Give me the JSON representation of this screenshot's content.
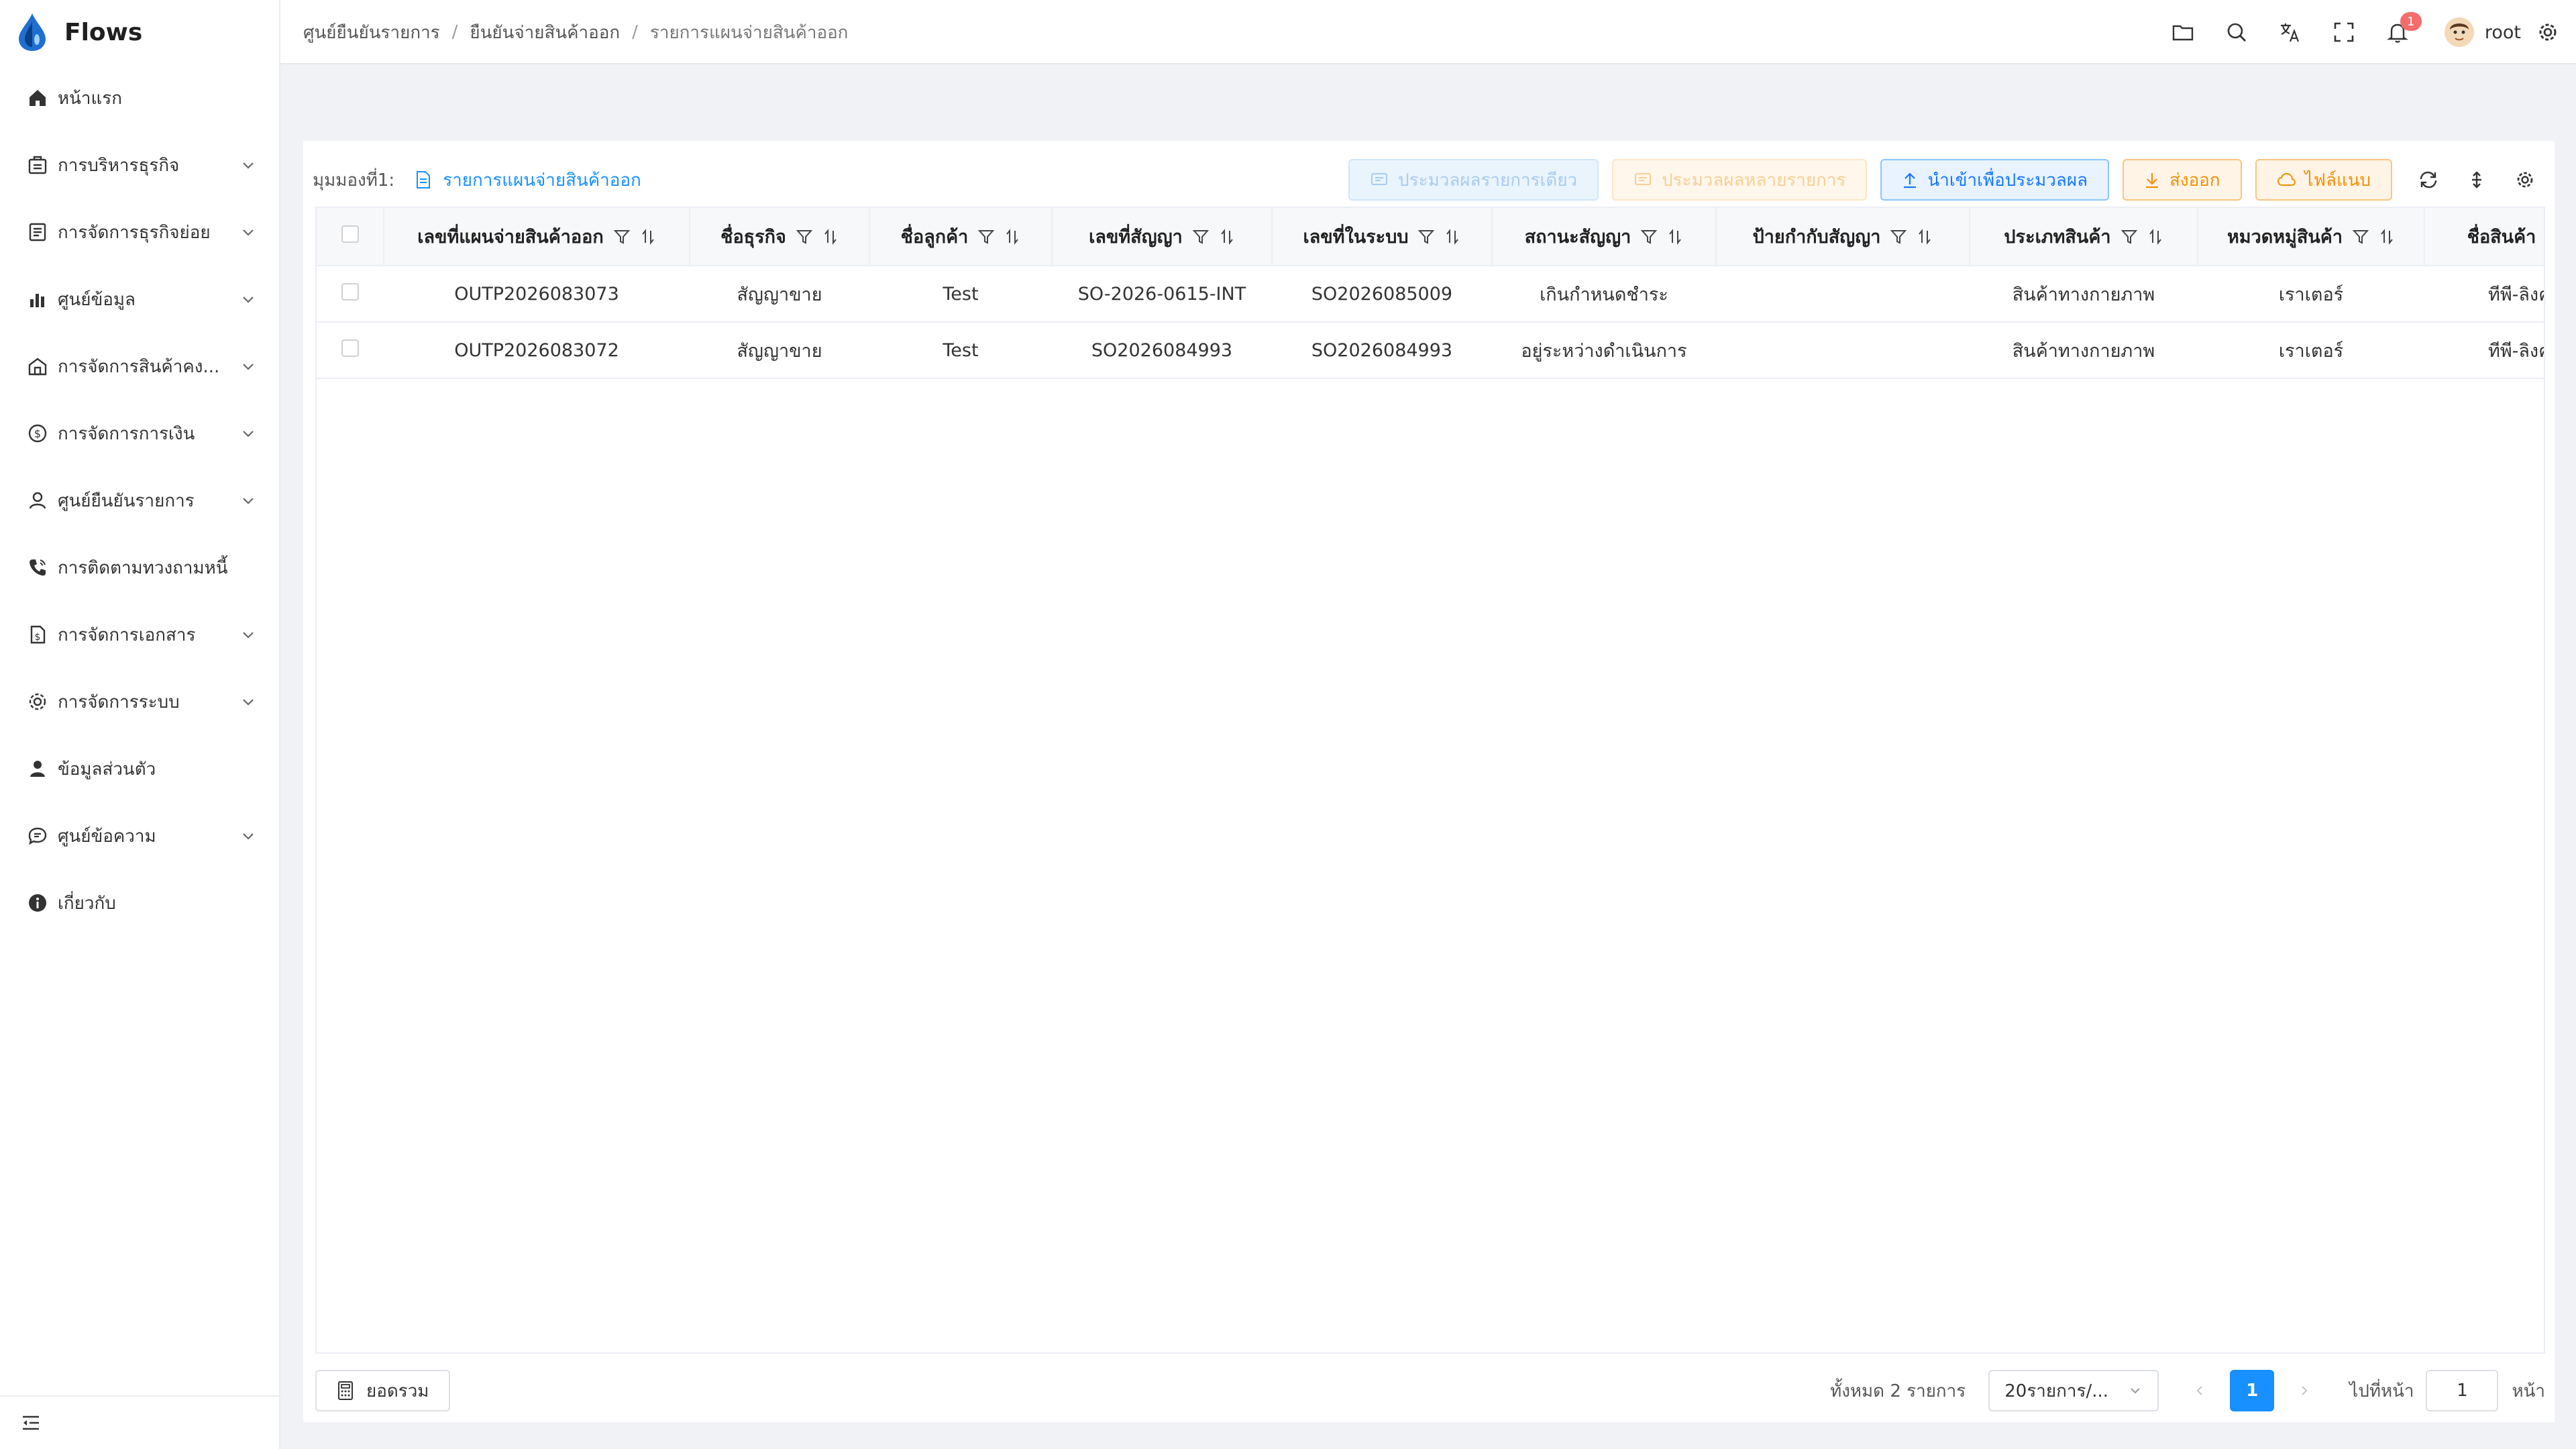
{
  "app": {
    "title": "Flows",
    "accent": "#1890ff"
  },
  "sidebar": {
    "items": [
      {
        "label": "หน้าแรก",
        "icon": "home-icon",
        "expandable": false
      },
      {
        "label": "การบริหารธุรกิจ",
        "icon": "briefcase-icon",
        "expandable": true
      },
      {
        "label": "การจัดการธุรกิจย่อย",
        "icon": "document-list-icon",
        "expandable": true
      },
      {
        "label": "ศูนย์ข้อมูล",
        "icon": "bar-chart-icon",
        "expandable": true
      },
      {
        "label": "การจัดการสินค้าคง...",
        "icon": "warehouse-icon",
        "expandable": true
      },
      {
        "label": "การจัดการการเงิน",
        "icon": "money-icon",
        "expandable": true
      },
      {
        "label": "ศูนย์ยืนยันรายการ",
        "icon": "user-check-icon",
        "expandable": true
      },
      {
        "label": "การติดตามทวงถามหนี้",
        "icon": "phone-icon",
        "expandable": false
      },
      {
        "label": "การจัดการเอกสาร",
        "icon": "file-dollar-icon",
        "expandable": true
      },
      {
        "label": "การจัดการระบบ",
        "icon": "gear-icon",
        "expandable": true
      },
      {
        "label": "ข้อมูลส่วนตัว",
        "icon": "person-icon",
        "expandable": false
      },
      {
        "label": "ศูนย์ข้อความ",
        "icon": "chat-icon",
        "expandable": true
      },
      {
        "label": "เกี่ยวกับ",
        "icon": "info-icon",
        "expandable": false
      }
    ]
  },
  "header": {
    "breadcrumb": [
      "ศูนย์ยืนยันรายการ",
      "ยืนยันจ่ายสินค้าออก",
      "รายการแผนจ่ายสินค้าออก"
    ],
    "notification_count": "1",
    "username": "root"
  },
  "viewbar": {
    "label": "มุมมองที่1:",
    "view_name": "รายการแผนจ่ายสินค้าออก",
    "buttons": {
      "single": "ประมวลผลรายการเดียว",
      "multi": "ประมวลผลหลายรายการ",
      "import": "นำเข้าเพื่อประมวลผล",
      "export": "ส่งออก",
      "attach": "ไฟล์แนบ"
    }
  },
  "table": {
    "columns": [
      "เลขที่แผนจ่ายสินค้าออก",
      "ชื่อธุรกิจ",
      "ชื่อลูกค้า",
      "เลขที่สัญญา",
      "เลขที่ในระบบ",
      "สถานะสัญญา",
      "ป้ายกำกับสัญญา",
      "ประเภทสินค้า",
      "หมวดหมู่สินค้า",
      "ชื่อสินค้า"
    ],
    "rows": [
      [
        "OUTP2026083073",
        "สัญญาขาย",
        "Test",
        "SO-2026-0615-INT",
        "SO2026085009",
        "เกินกำหนดชำระ",
        "",
        "สินค้าทางกายภาพ",
        "เราเตอร์",
        "ทีพี-ลิงค์ อ"
      ],
      [
        "OUTP2026083072",
        "สัญญาขาย",
        "Test",
        "SO2026084993",
        "SO2026084993",
        "อยู่ระหว่างดำเนินการ",
        "",
        "สินค้าทางกายภาพ",
        "เราเตอร์",
        "ทีพี-ลิงค์ อ"
      ]
    ]
  },
  "footer": {
    "summary_label": "ยอดรวม",
    "total_text": "ทั้งหมด 2 รายการ",
    "page_size": "20รายการ/...",
    "current_page": "1",
    "goto_label": "ไปที่หน้า",
    "goto_value": "1",
    "goto_suffix": "หน้า"
  }
}
